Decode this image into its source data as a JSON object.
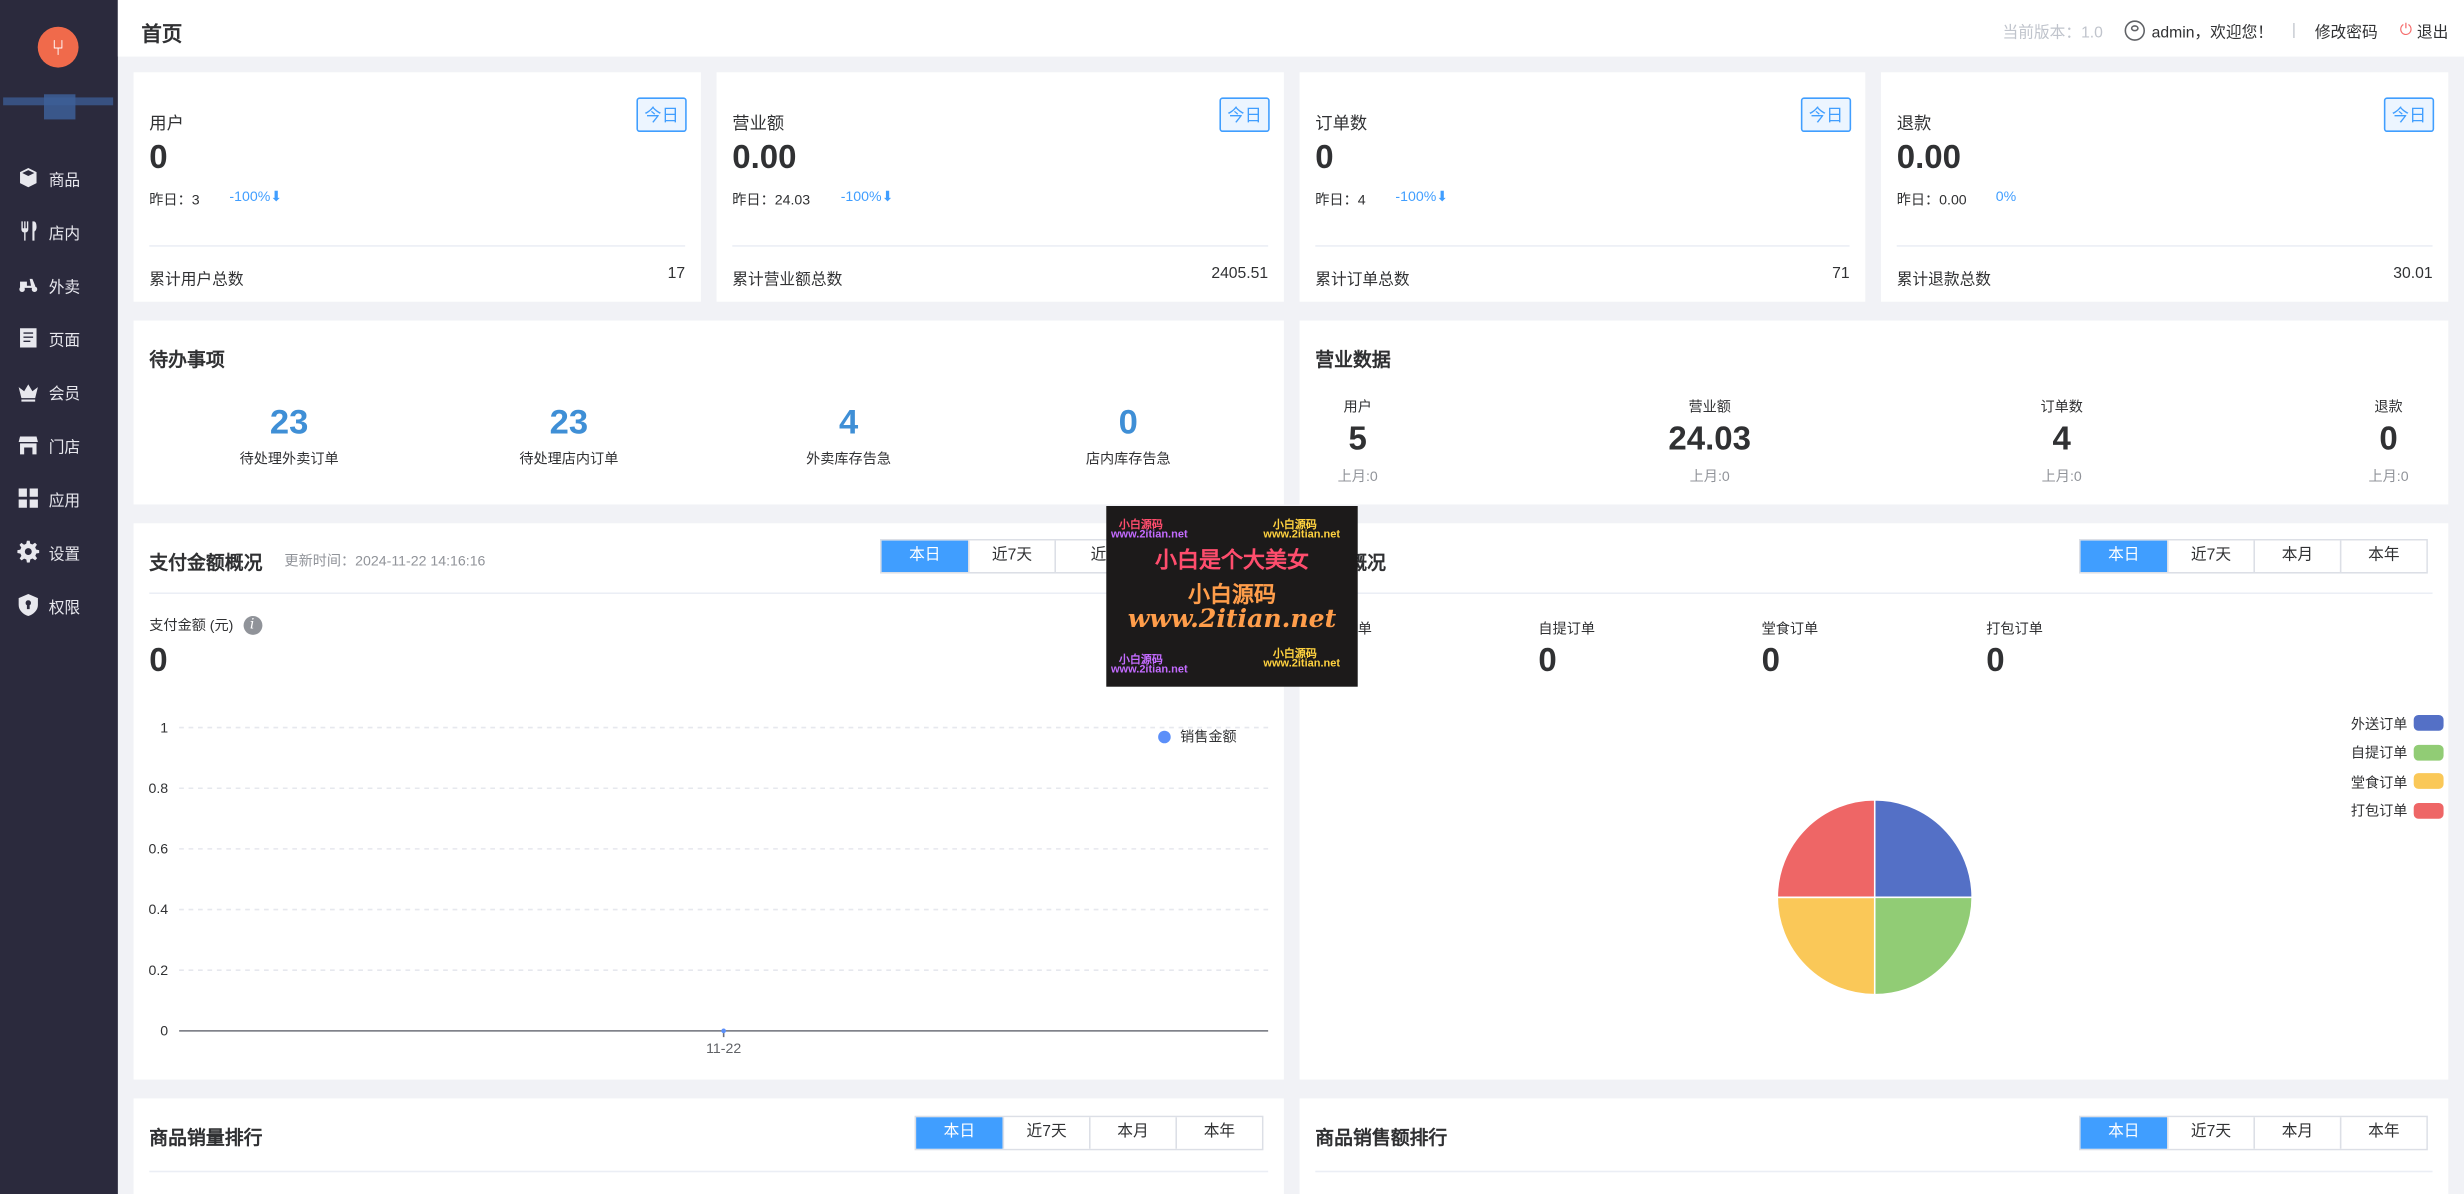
{
  "sidebar": {
    "items": [
      {
        "label": "商品",
        "icon": "box-icon"
      },
      {
        "label": "店内",
        "icon": "fork-spoon-icon"
      },
      {
        "label": "外卖",
        "icon": "scooter-icon"
      },
      {
        "label": "页面",
        "icon": "page-icon"
      },
      {
        "label": "会员",
        "icon": "crown-icon"
      },
      {
        "label": "门店",
        "icon": "store-icon"
      },
      {
        "label": "应用",
        "icon": "apps-icon"
      },
      {
        "label": "设置",
        "icon": "gear-icon"
      },
      {
        "label": "权限",
        "icon": "shield-icon"
      }
    ]
  },
  "header": {
    "title": "首页",
    "version": "当前版本：1.0",
    "welcome": "admin，欢迎您！",
    "separator": "|",
    "change_password": "修改密码",
    "logout": "退出"
  },
  "stats": [
    {
      "title": "用户",
      "tag": "今日",
      "value": "0",
      "yesterday": "昨日：3",
      "change": "-100%⬇",
      "total_label": "累计用户总数",
      "total_value": "17"
    },
    {
      "title": "营业额",
      "tag": "今日",
      "value": "0.00",
      "yesterday": "昨日：24.03",
      "change": "-100%⬇",
      "total_label": "累计营业额总数",
      "total_value": "2405.51"
    },
    {
      "title": "订单数",
      "tag": "今日",
      "value": "0",
      "yesterday": "昨日：4",
      "change": "-100%⬇",
      "total_label": "累计订单总数",
      "total_value": "71"
    },
    {
      "title": "退款",
      "tag": "今日",
      "value": "0.00",
      "yesterday": "昨日：0.00",
      "change": "0%",
      "total_label": "累计退款总数",
      "total_value": "30.01"
    }
  ],
  "todo": {
    "title": "待办事项",
    "items": [
      {
        "value": "23",
        "label": "待处理外卖订单"
      },
      {
        "value": "23",
        "label": "待处理店内订单"
      },
      {
        "value": "4",
        "label": "外卖库存告急"
      },
      {
        "value": "0",
        "label": "店内库存告急"
      }
    ]
  },
  "business": {
    "title": "营业数据",
    "items": [
      {
        "label": "用户",
        "value": "5",
        "last": "上月:0"
      },
      {
        "label": "营业额",
        "value": "24.03",
        "last": "上月:0"
      },
      {
        "label": "订单数",
        "value": "4",
        "last": "上月:0"
      },
      {
        "label": "退款",
        "value": "0",
        "last": "上月:0"
      }
    ]
  },
  "payment": {
    "title": "支付金额概况",
    "updated": "更新时间：2024-11-22 14:16:16",
    "tabs": [
      "本日",
      "近7天",
      "近"
    ],
    "amount_label": "支付金额 (元)",
    "info_icon": "i",
    "amount_value": "0"
  },
  "orders_overview": {
    "title": "概况",
    "tabs": [
      "本日",
      "近7天",
      "本月",
      "本年"
    ],
    "items": [
      {
        "label": "单",
        "value": ""
      },
      {
        "label": "自提订单",
        "value": "0"
      },
      {
        "label": "堂食订单",
        "value": "0"
      },
      {
        "label": "打包订单",
        "value": "0"
      }
    ]
  },
  "sales_rank": {
    "title": "商品销量排行",
    "tabs": [
      "本日",
      "近7天",
      "本月",
      "本年"
    ]
  },
  "revenue_rank": {
    "title": "商品销售额排行",
    "tabs": [
      "本日",
      "近7天",
      "本月",
      "本年"
    ]
  },
  "watermark": {
    "small": [
      "小白源码",
      "www.2itian.net"
    ],
    "title": "小白是个大美女",
    "subtitle": "小白源码",
    "url": "www.2itian.net"
  },
  "chart_data": [
    {
      "type": "line",
      "categories": [
        "11-22"
      ],
      "series": [
        {
          "name": "销售金额",
          "values": [
            0
          ]
        }
      ],
      "yticks": [
        "0",
        "0.2",
        "0.4",
        "0.6",
        "0.8",
        "1"
      ],
      "ylim": [
        0,
        1
      ],
      "grid": true,
      "legend": "top-right",
      "color": "#5b8ff9"
    },
    {
      "type": "pie",
      "categories": [
        "外送订单",
        "自提订单",
        "堂食订单",
        "打包订单"
      ],
      "values": [
        1,
        1,
        1,
        1
      ],
      "colors": [
        "#5470c6",
        "#91cc75",
        "#fac858",
        "#ee6666"
      ],
      "legend": "top-right"
    }
  ]
}
